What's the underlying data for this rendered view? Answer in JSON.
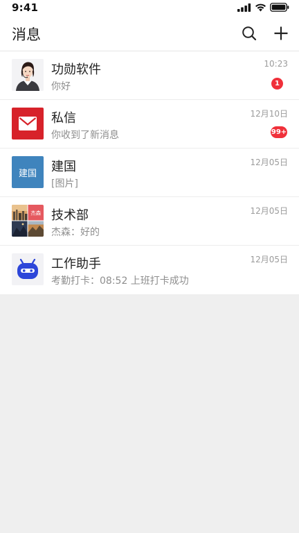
{
  "status_bar": {
    "time": "9:41",
    "icons": [
      "cellular-signal-icon",
      "wifi-icon",
      "battery-icon"
    ]
  },
  "header": {
    "title": "消息",
    "search_icon": "search-icon",
    "add_icon": "plus-icon"
  },
  "conversations": [
    {
      "name": "功勋软件",
      "preview": "你好",
      "time": "10:23",
      "badge": "1",
      "avatar": "customer-service-avatar"
    },
    {
      "name": "私信",
      "preview": "你收到了新消息",
      "time": "12月10日",
      "badge": "99+",
      "avatar": "mail-icon"
    },
    {
      "name": "建国",
      "preview": "[图片]",
      "time": "12月05日",
      "avatar_text": "建国"
    },
    {
      "name": "技术部",
      "preview": "杰森：好的",
      "time": "12月05日",
      "avatar": "group-avatar",
      "avatar_tile_text": "杰森"
    },
    {
      "name": "工作助手",
      "preview": "考勤打卡：08:52 上班打卡成功",
      "time": "12月05日",
      "avatar": "robot-icon"
    }
  ],
  "colors": {
    "badge": "#f0303a",
    "mail_avatar": "#d7222a",
    "text_avatar": "#3f84bd",
    "robot": "#2d46d9",
    "background": "#efefef"
  }
}
